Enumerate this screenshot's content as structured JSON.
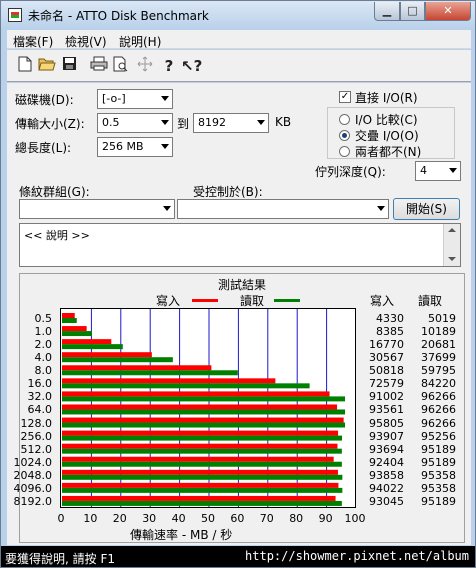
{
  "window": {
    "title": "未命名 - ATTO Disk Benchmark"
  },
  "menu": {
    "file": "檔案(F)",
    "view": "檢視(V)",
    "help": "說明(H)"
  },
  "toolbar": {
    "icons": [
      "new-icon",
      "open-icon",
      "save-icon",
      "print-icon",
      "print-preview-icon",
      "move-icon",
      "help-icon",
      "context-help-icon"
    ]
  },
  "settings": {
    "drive_label": "磁碟機(D):",
    "drive_value": "[-o-]",
    "transfer_label": "傳輸大小(Z):",
    "transfer_from": "0.5",
    "to_label": "到",
    "transfer_to": "8192",
    "unit_label": "KB",
    "length_label": "總長度(L):",
    "length_value": "256 MB",
    "direct_io_label": "直接 I/O(R)",
    "io_compare_label": "I/O 比較(C)",
    "overlap_io_label": "交疊 I/O(O)",
    "neither_label": "兩者都不(N)",
    "queue_depth_label": "佇列深度(Q):",
    "queue_depth_value": "4",
    "stripe_group_label": "條紋群組(G):",
    "controlled_by_label": "受控制於(B):",
    "start_button": "開始(S)",
    "description": "<< 說明 >>"
  },
  "results": {
    "title": "測試結果",
    "legend_write": "寫入",
    "legend_read": "讀取",
    "col_write": "寫入",
    "col_read": "讀取",
    "write_color": "#ff0000",
    "read_color": "#008000"
  },
  "chart_data": {
    "type": "bar",
    "orientation": "horizontal",
    "title": "測試結果",
    "xlabel": "傳輸速率 - MB / 秒",
    "ylabel": "",
    "xlim": [
      0,
      100
    ],
    "xticks": [
      "0",
      "10",
      "20",
      "30",
      "40",
      "50",
      "60",
      "70",
      "80",
      "90",
      "100"
    ],
    "categories": [
      "0.5",
      "1.0",
      "2.0",
      "4.0",
      "8.0",
      "16.0",
      "32.0",
      "64.0",
      "128.0",
      "256.0",
      "512.0",
      "1024.0",
      "2048.0",
      "4096.0",
      "8192.0"
    ],
    "series": [
      {
        "name": "寫入",
        "color": "#ff0000",
        "values": [
          4.33,
          8.385,
          16.77,
          30.567,
          50.818,
          72.579,
          91.002,
          93.561,
          95.805,
          93.907,
          93.694,
          92.404,
          93.858,
          94.022,
          93.045
        ],
        "labels": [
          "4330",
          "8385",
          "16770",
          "30567",
          "50818",
          "72579",
          "91002",
          "93561",
          "95805",
          "93907",
          "93694",
          "92404",
          "93858",
          "94022",
          "93045"
        ]
      },
      {
        "name": "讀取",
        "color": "#008000",
        "values": [
          5.019,
          10.189,
          20.681,
          37.699,
          59.795,
          84.22,
          96.266,
          96.266,
          96.266,
          95.256,
          95.189,
          95.189,
          95.358,
          95.358,
          95.189
        ],
        "labels": [
          "5019",
          "10189",
          "20681",
          "37699",
          "59795",
          "84220",
          "96266",
          "96266",
          "96266",
          "95256",
          "95189",
          "95189",
          "95358",
          "95358",
          "95189"
        ]
      }
    ],
    "grid": true
  },
  "status": {
    "text": "要獲得說明, 請按 F1",
    "watermark": "http://showmer.pixnet.net/album"
  }
}
